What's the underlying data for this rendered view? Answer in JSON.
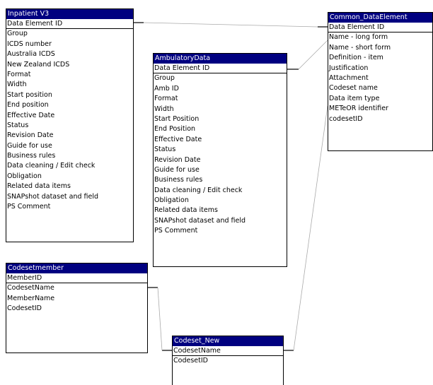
{
  "tables": [
    {
      "key": "inpatient",
      "title": "Inpatient V3",
      "fields": [
        "Data Element ID",
        "Group",
        "ICDS number",
        "Australia ICDS",
        "New Zealand ICDS",
        "Format",
        "Width",
        "Start position",
        "End position",
        "Effective Date",
        "Status",
        "Revision Date",
        "Guide for use",
        "Business rules",
        "Data cleaning / Edit check",
        "Obligation",
        "Related data items",
        "SNAPshot dataset and field",
        "PS Comment"
      ]
    },
    {
      "key": "ambulatory",
      "title": "AmbulatoryData",
      "fields": [
        "Data Element ID",
        "Group",
        "Amb ID",
        "Format",
        "Width",
        "Start Position",
        "End Position",
        "Effective Date",
        "Status",
        "Revision Date",
        "Guide for use",
        "Business rules",
        "Data cleaning / Edit check",
        "Obligation",
        "Related data items",
        "SNAPshot dataset and field",
        "PS Comment"
      ]
    },
    {
      "key": "common",
      "title": "Common_DataElement",
      "fields": [
        "Data Element ID",
        "Name - long form",
        "Name - short form",
        "Definition - item",
        "Justification",
        "Attachment",
        "Codeset name",
        "Data item type",
        "METeOR identifier",
        "codesetID"
      ]
    },
    {
      "key": "codesetmember",
      "title": "Codesetmember",
      "fields": [
        "MemberID",
        "CodesetName",
        "MemberName",
        "CodesetID"
      ]
    },
    {
      "key": "codesetnew",
      "title": "Codeset_New",
      "fields": [
        "CodesetName",
        "CodesetID"
      ]
    }
  ],
  "colors": {
    "title_bar": "#000080",
    "title_text": "#ffffff",
    "border": "#000000",
    "connector": "#999999"
  }
}
